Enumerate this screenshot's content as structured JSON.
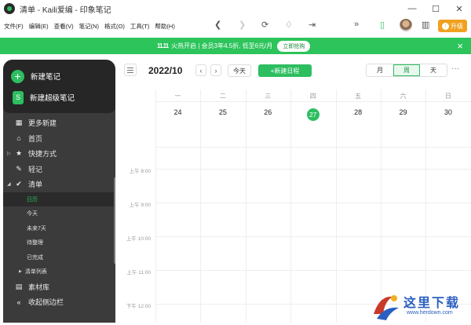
{
  "window": {
    "title": "清单 - Kaili爱编 - 印象笔记",
    "controls": [
      "—",
      "☐",
      "✕"
    ]
  },
  "menu": [
    "文件(F)",
    "编辑(E)",
    "查看(V)",
    "笔记(N)",
    "格式(O)",
    "工具(T)",
    "帮助(H)"
  ],
  "toolbar": {
    "upgrade_label": "升级",
    "overflow": "»"
  },
  "banner": {
    "icon_text": "11.11",
    "text": "火热开启 | 会员3年4.5折, 低至6元/月",
    "button": "立即抢购",
    "close": "×"
  },
  "sidebar": {
    "new_note": "新建笔记",
    "new_super_note": "新建超级笔记",
    "items": [
      {
        "label": "更多新建",
        "icon": "grid-icon",
        "glyph": "▦"
      },
      {
        "label": "首页",
        "icon": "home-icon",
        "glyph": "⌂"
      },
      {
        "label": "快捷方式",
        "icon": "star-icon",
        "glyph": "★",
        "caret": "▷"
      },
      {
        "label": "轻记",
        "icon": "pen-icon",
        "glyph": "✎"
      },
      {
        "label": "清单",
        "icon": "check-icon",
        "glyph": "✔",
        "caret": "◢"
      }
    ],
    "todo_sub": [
      "日历",
      "今天",
      "未来7天",
      "待整理",
      "已完成"
    ],
    "todo_list": "清单列表",
    "tail_items": [
      {
        "label": "素材库",
        "icon": "library-icon",
        "glyph": "▤"
      },
      {
        "label": "收起侧边栏",
        "icon": "collapse-icon",
        "glyph": "«"
      }
    ]
  },
  "calendar": {
    "period": "2022/10",
    "prev": "‹",
    "next": "›",
    "today": "今天",
    "new_event": "+新建日程",
    "views": [
      "月",
      "周",
      "天"
    ],
    "active_view": "周",
    "more": "···",
    "weekdays": [
      "一",
      "二",
      "三",
      "四",
      "五",
      "六",
      "日"
    ],
    "dates": [
      "24",
      "25",
      "26",
      "27",
      "28",
      "29",
      "30"
    ],
    "today_index": 3,
    "times": [
      "上午 8:00",
      "上午 9:00",
      "上午 10:00",
      "上午 11:00",
      "下午 12:00"
    ]
  },
  "watermark": {
    "text": "这里下载",
    "url": "www.herdown.com"
  },
  "colors": {
    "accent": "#2dbe60",
    "banner": "#2cc45b",
    "sidebar": "#3b3b3b",
    "sidebar_top": "#262626",
    "upgrade": "#f0a020"
  }
}
